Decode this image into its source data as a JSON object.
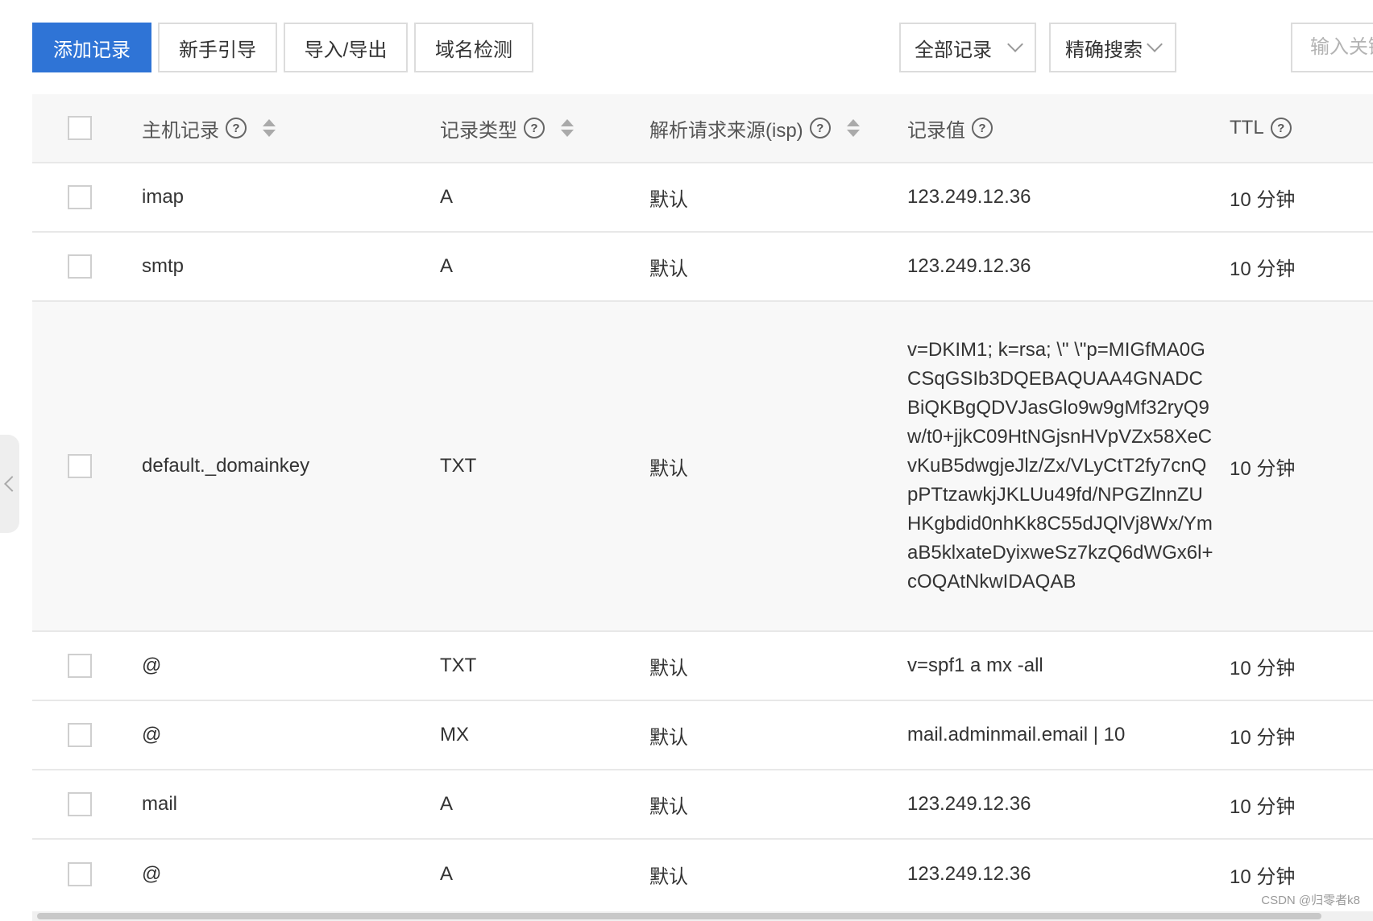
{
  "toolbar": {
    "add_record": "添加记录",
    "guide": "新手引导",
    "import_export": "导入/导出",
    "domain_check": "域名检测",
    "record_filter": "全部记录",
    "search_mode": "精确搜索",
    "search_placeholder": "输入关键字"
  },
  "table": {
    "columns": {
      "host": "主机记录",
      "type": "记录类型",
      "isp": "解析请求来源(isp)",
      "value": "记录值",
      "ttl": "TTL"
    },
    "rows": [
      {
        "host": "imap",
        "type": "A",
        "isp": "默认",
        "value": "123.249.12.36",
        "ttl": "10 分钟"
      },
      {
        "host": "smtp",
        "type": "A",
        "isp": "默认",
        "value": "123.249.12.36",
        "ttl": "10 分钟"
      },
      {
        "host": "default._domainkey",
        "type": "TXT",
        "isp": "默认",
        "value": "v=DKIM1; k=rsa; \\\" \\\"p=MIGfMA0GCSqGSIb3DQEBAQUAA4GNADCBiQKBgQDVJasGlo9w9gMf32ryQ9w/t0+jjkC09HtNGjsnHVpVZx58XeCvKuB5dwgjeJlz/Zx/VLyCtT2fy7cnQpPTtzawkjJKLUu49fd/NPGZlnnZUHKgbdid0nhKk8C55dJQlVj8Wx/YmaB5klxateDyixweSz7kzQ6dWGx6l+cOQAtNkwIDAQAB",
        "ttl": "10 分钟"
      },
      {
        "host": "@",
        "type": "TXT",
        "isp": "默认",
        "value": "v=spf1 a mx -all",
        "ttl": "10 分钟"
      },
      {
        "host": "@",
        "type": "MX",
        "isp": "默认",
        "value": "mail.adminmail.email | 10",
        "ttl": "10 分钟"
      },
      {
        "host": "mail",
        "type": "A",
        "isp": "默认",
        "value": "123.249.12.36",
        "ttl": "10 分钟"
      },
      {
        "host": "@",
        "type": "A",
        "isp": "默认",
        "value": "123.249.12.36",
        "ttl": "10 分钟"
      }
    ]
  },
  "watermark": "CSDN @归零者k8"
}
